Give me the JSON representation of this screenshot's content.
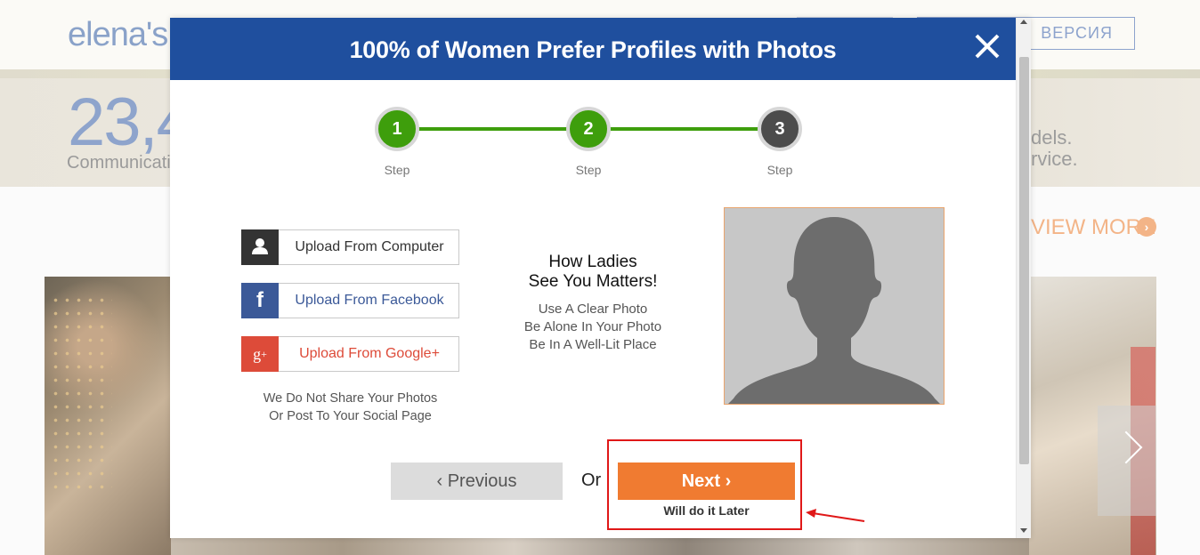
{
  "background": {
    "logo": "elena's",
    "lang_button": "ВЕРСИЯ",
    "stat_number": "23,4",
    "stat_label": "Communicatio",
    "right_text_line1": "dels.",
    "right_text_line2": "rvice.",
    "view_more": "VIEW MORE"
  },
  "modal": {
    "title": "100% of Women Prefer Profiles with Photos",
    "steps": [
      {
        "number": "1",
        "label": "Step",
        "state": "done",
        "color": "#3e9e0c"
      },
      {
        "number": "2",
        "label": "Step",
        "state": "done",
        "color": "#3e9e0c"
      },
      {
        "number": "3",
        "label": "Step",
        "state": "current",
        "color": "#4c4c4c"
      }
    ],
    "upload": {
      "computer": "Upload From Computer",
      "facebook": "Upload From Facebook",
      "google": "Upload From Google+",
      "privacy_line1": "We Do Not Share Your Photos",
      "privacy_line2": "Or Post To Your Social Page"
    },
    "tips": {
      "title_line1": "How Ladies",
      "title_line2": "See You Matters!",
      "items": [
        "Use A Clear Photo",
        "Be Alone In Your Photo",
        "Be In A Well-Lit Place"
      ]
    },
    "nav": {
      "previous": "‹ Previous",
      "or": "Or",
      "next": "Next ›",
      "later": "Will do it Later"
    }
  },
  "colors": {
    "header_blue": "#1f4f9e",
    "accent_orange": "#f07b31",
    "step_green": "#3e9e0c",
    "facebook_blue": "#3b5998",
    "google_red": "#dd4b39",
    "annotation_red": "#e01818"
  },
  "icons": {
    "close": "close-icon",
    "computer": "user-icon",
    "facebook": "facebook-icon",
    "google": "google-plus-icon",
    "view_more": "chevron-right-circle-icon"
  }
}
